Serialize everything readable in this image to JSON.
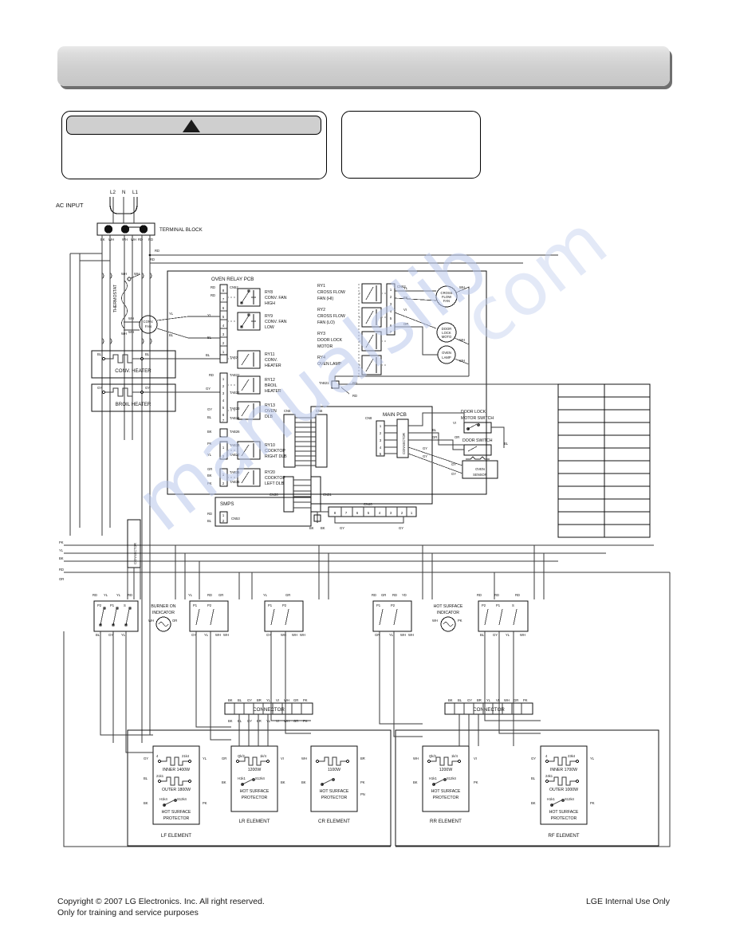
{
  "page": {
    "header_title": "",
    "watermark": "manualslib",
    "watermark_right": "com"
  },
  "warning": {
    "icon": "warning-triangle-icon",
    "title": "",
    "body": ""
  },
  "note": {
    "body": ""
  },
  "footer": {
    "copyright_line1": "Copyright © 2007 LG Electronics. Inc. All right reserved.",
    "copyright_line2": "Only for training and service purposes",
    "internal_use": "LGE Internal Use Only"
  },
  "schematic": {
    "title": "electric-range-wiring-diagram",
    "power": {
      "ac_input": "AC  INPUT",
      "terminals": [
        "L2",
        "N",
        "L1"
      ],
      "terminal_block": "TERMINAL BLOCK",
      "thermostat": "THERMOSTAT"
    },
    "oven_relay_pcb": {
      "label": "OVEN RELAY PCB",
      "relays": [
        {
          "id": "RY8",
          "lines": [
            "RY8",
            "CONV. FAN",
            "HIGH"
          ]
        },
        {
          "id": "RY9",
          "lines": [
            "RY9",
            "CONV. FAN",
            "LOW"
          ]
        },
        {
          "id": "RY11",
          "lines": [
            "RY11",
            "CONV.",
            "HEATER"
          ]
        },
        {
          "id": "RY12",
          "lines": [
            "RY12",
            "BROIL",
            "HEATER"
          ]
        },
        {
          "id": "RY13",
          "lines": [
            "RY13",
            "OVEN",
            "DLB"
          ]
        },
        {
          "id": "RY10",
          "lines": [
            "RY10",
            "COOKTOP",
            "RIGHT DLB"
          ]
        },
        {
          "id": "RY20",
          "lines": [
            "RY20",
            "COOKTOP",
            "LEFT DLB"
          ]
        }
      ],
      "relays_right": [
        {
          "id": "RY1",
          "lines": [
            "RY1",
            "CROSS FLOW",
            "FAN (HI)"
          ]
        },
        {
          "id": "RY2",
          "lines": [
            "RY2",
            "CROSS FLOW",
            "FAN (LO)"
          ]
        },
        {
          "id": "RY3",
          "lines": [
            "RY3",
            "DOOR LOCK",
            "MOTOR"
          ]
        },
        {
          "id": "RY4",
          "lines": [
            "RY4",
            "OVEN LAMP"
          ]
        }
      ],
      "connectors": [
        "CN52",
        "TAB2",
        "TAB22",
        "TAB23",
        "TAB24",
        "TAB25",
        "TAB27",
        "TAB35",
        "TAB36",
        "TAB26",
        "CN53",
        "CN51"
      ],
      "smps": "SMPS"
    },
    "heaters": {
      "conv_heater": "CONV.  HEATER",
      "broil_heater": "BROIL  HEATER",
      "conv_fan": "CONV.\nFAN"
    },
    "motors": [
      {
        "label": "CROSS\nFLOW\nFAN"
      },
      {
        "label": "DOOR\nLOCK\nMOTO"
      },
      {
        "label": "OVEN\nLAMP"
      }
    ],
    "main_pcb": {
      "label": "MAIN PCB",
      "connectors": [
        "CN5",
        "CN6",
        "CN30",
        "CN31",
        "CN8",
        "CN40"
      ],
      "cn40_pins": [
        "8",
        "7",
        "6",
        "5",
        "4",
        "3",
        "2",
        "1"
      ],
      "door_lock_motor_switch": "DOOR LOCK\nMOTOR SWITCH",
      "door_switch": "DOOR SWITCH",
      "oven_sensor": "OVEN\nSENSOR",
      "connector": "CONNECTOR"
    },
    "indicators": [
      {
        "label": "BURNER ON\nINDICATOR"
      },
      {
        "label": "HOT SURFACE\nINDICATOR"
      }
    ],
    "connectors": [
      "CONNECTOR",
      "CONNECTOR",
      "CONNECTOR"
    ],
    "elements": [
      {
        "name": "LF ELEMENT",
        "coils": [
          {
            "label": "INNER 1400W",
            "pins": [
              "4",
              "21k4"
            ]
          },
          {
            "label": "OUTER 1800W",
            "pins": [
              "21k1",
              ""
            ]
          }
        ],
        "protector": "HOT SURFACE\nPROTECTOR",
        "protector_pins": [
          "H1k4",
          "S12k4"
        ]
      },
      {
        "name": "LR ELEMENT",
        "coils": [
          {
            "label": "1200W",
            "pins": [
              "Qk/2",
              "1k/4"
            ]
          }
        ],
        "protector": "HOT SURFACE\nPROTECTOR",
        "protector_pins": [
          "H1k1",
          "S12k4"
        ]
      },
      {
        "name": "CR ELEMENT",
        "coils": [
          {
            "label": "1100W",
            "pins": [
              "",
              ""
            ]
          }
        ],
        "protector": "HOT SURFACE\nPROTECTOR",
        "protector_pins": [
          "",
          ""
        ]
      },
      {
        "name": "RR ELEMENT",
        "coils": [
          {
            "label": "1200W",
            "pins": [
              "Qk/2",
              "1k/4"
            ]
          }
        ],
        "protector": "HOT SURFACE\nPROTECTOR",
        "protector_pins": [
          "H1k1",
          "S12k4"
        ]
      },
      {
        "name": "RF ELEMENT",
        "coils": [
          {
            "label": "INNER 1700W",
            "pins": [
              "4",
              "23k4"
            ]
          },
          {
            "label": "OUTER 1000W",
            "pins": [
              "24k1",
              ""
            ]
          }
        ],
        "protector": "HOT SURFACE\nPROTECTOR",
        "protector_pins": [
          "H1k1",
          "S12k4"
        ]
      }
    ],
    "legend_table": {
      "rows": 12,
      "cols": 2,
      "cells": [
        [
          "",
          ""
        ],
        [
          "",
          ""
        ],
        [
          "",
          ""
        ],
        [
          "",
          ""
        ],
        [
          "",
          ""
        ],
        [
          "",
          ""
        ],
        [
          "",
          ""
        ],
        [
          "",
          ""
        ],
        [
          "",
          ""
        ],
        [
          "",
          ""
        ],
        [
          "",
          ""
        ],
        [
          "",
          ""
        ]
      ]
    },
    "wire_codes": [
      "BK",
      "WH",
      "RD",
      "BL",
      "YL",
      "GY",
      "OR",
      "PK",
      "BR",
      "VI",
      "GR"
    ]
  }
}
